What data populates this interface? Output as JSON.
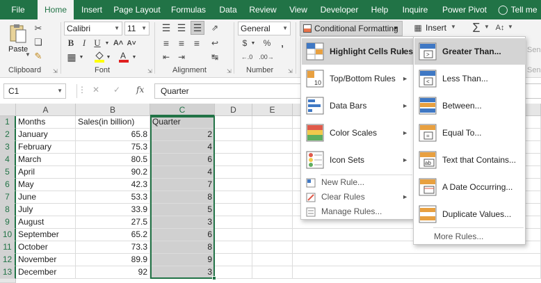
{
  "ribbon": {
    "tabs": [
      "File",
      "Home",
      "Insert",
      "Page Layout",
      "Formulas",
      "Data",
      "Review",
      "View",
      "Developer",
      "Help",
      "Inquire",
      "Power Pivot",
      "Tell me"
    ],
    "active_tab": "Home",
    "font_name": "Calibri",
    "font_size": "11",
    "number_format": "General",
    "paste_label": "Paste",
    "conditional_formatting": "Conditional Formatting",
    "insert_label": "Insert",
    "number_symbols": {
      "currency": "$",
      "percent": "%",
      "comma": ","
    },
    "group_labels": [
      "Clipboard",
      "Font",
      "Alignment",
      "Number",
      "Sens"
    ],
    "faded_side_labels": [
      "Sens",
      "Sens"
    ]
  },
  "formula_bar": {
    "name_box": "C1",
    "content": "Quarter",
    "fx": "fx"
  },
  "sheet": {
    "columns": [
      "A",
      "B",
      "C",
      "D",
      "E"
    ],
    "rows": [
      "1",
      "2",
      "3",
      "4",
      "5",
      "6",
      "7",
      "8",
      "9",
      "10",
      "11",
      "12",
      "13"
    ],
    "headers": [
      "Months",
      "Sales(in billion)",
      "Quarter"
    ],
    "data": [
      [
        "January",
        "65.8",
        "2"
      ],
      [
        "February",
        "75.3",
        "4"
      ],
      [
        "March",
        "80.5",
        "6"
      ],
      [
        "April",
        "90.2",
        "4"
      ],
      [
        "May",
        "42.3",
        "7"
      ],
      [
        "June",
        "53.3",
        "8"
      ],
      [
        "July",
        "33.9",
        "5"
      ],
      [
        "August",
        "27.5",
        "3"
      ],
      [
        "September",
        "65.2",
        "6"
      ],
      [
        "October",
        "73.3",
        "8"
      ],
      [
        "November",
        "89.9",
        "9"
      ],
      [
        "December",
        "92",
        "3"
      ]
    ]
  },
  "cf_menu": {
    "items": [
      {
        "label": "Highlight Cells Rules",
        "icon": "highlight-cells-icon"
      },
      {
        "label": "Top/Bottom Rules",
        "icon": "top-bottom-icon"
      },
      {
        "label": "Data Bars",
        "icon": "data-bars-icon"
      },
      {
        "label": "Color Scales",
        "icon": "color-scales-icon"
      },
      {
        "label": "Icon Sets",
        "icon": "icon-sets-icon"
      }
    ],
    "small_items": [
      {
        "label": "New Rule...",
        "icon": "new-rule-icon"
      },
      {
        "label": "Clear Rules",
        "icon": "clear-rules-icon"
      },
      {
        "label": "Manage Rules...",
        "icon": "manage-rules-icon"
      }
    ]
  },
  "hcr_menu": {
    "items": [
      {
        "label": "Greater Than...",
        "icon": "greater-than-icon"
      },
      {
        "label": "Less Than...",
        "icon": "less-than-icon"
      },
      {
        "label": "Between...",
        "icon": "between-icon"
      },
      {
        "label": "Equal To...",
        "icon": "equal-to-icon"
      },
      {
        "label": "Text that Contains...",
        "icon": "text-contains-icon"
      },
      {
        "label": "A Date Occurring...",
        "icon": "date-occurring-icon"
      },
      {
        "label": "Duplicate Values...",
        "icon": "duplicate-values-icon"
      }
    ],
    "more_rules": "More Rules..."
  },
  "colors": {
    "excel_green": "#217346",
    "selection_fill": "#d0d0d0",
    "menu_highlight": "#d4d4d4"
  }
}
